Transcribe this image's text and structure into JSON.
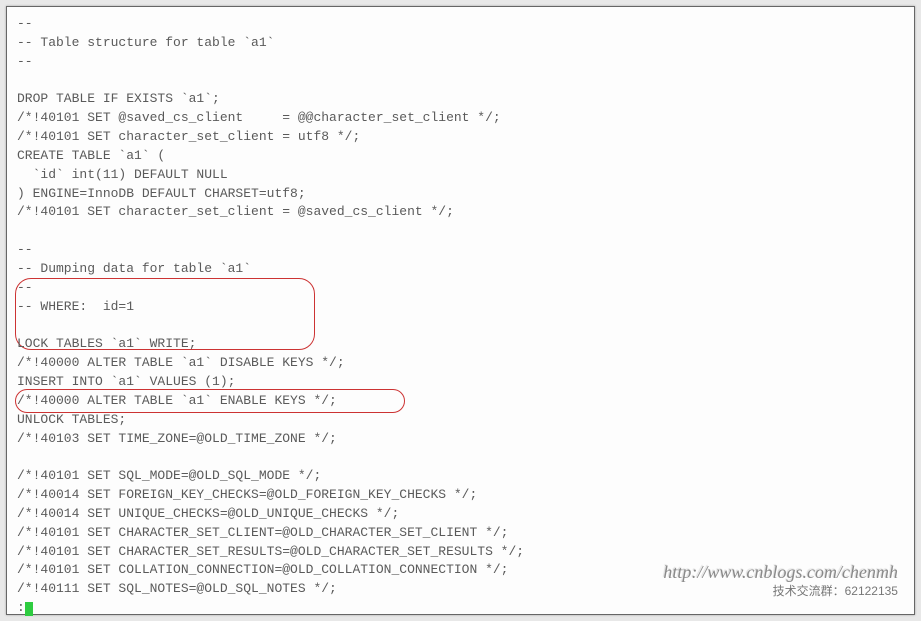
{
  "lines": [
    "--",
    "-- Table structure for table `a1`",
    "--",
    "",
    "DROP TABLE IF EXISTS `a1`;",
    "/*!40101 SET @saved_cs_client     = @@character_set_client */;",
    "/*!40101 SET character_set_client = utf8 */;",
    "CREATE TABLE `a1` (",
    "  `id` int(11) DEFAULT NULL",
    ") ENGINE=InnoDB DEFAULT CHARSET=utf8;",
    "/*!40101 SET character_set_client = @saved_cs_client */;",
    "",
    "--",
    "-- Dumping data for table `a1`",
    "--",
    "-- WHERE:  id=1",
    "",
    "LOCK TABLES `a1` WRITE;",
    "/*!40000 ALTER TABLE `a1` DISABLE KEYS */;",
    "INSERT INTO `a1` VALUES (1);",
    "/*!40000 ALTER TABLE `a1` ENABLE KEYS */;",
    "UNLOCK TABLES;",
    "/*!40103 SET TIME_ZONE=@OLD_TIME_ZONE */;",
    "",
    "/*!40101 SET SQL_MODE=@OLD_SQL_MODE */;",
    "/*!40014 SET FOREIGN_KEY_CHECKS=@OLD_FOREIGN_KEY_CHECKS */;",
    "/*!40014 SET UNIQUE_CHECKS=@OLD_UNIQUE_CHECKS */;",
    "/*!40101 SET CHARACTER_SET_CLIENT=@OLD_CHARACTER_SET_CLIENT */;",
    "/*!40101 SET CHARACTER_SET_RESULTS=@OLD_CHARACTER_SET_RESULTS */;",
    "/*!40101 SET COLLATION_CONNECTION=@OLD_COLLATION_CONNECTION */;",
    "/*!40111 SET SQL_NOTES=@OLD_SQL_NOTES */;"
  ],
  "prompt": {
    "symbol": ":"
  },
  "watermark": {
    "url": "http://www.cnblogs.com/chenmh",
    "group": "技术交流群：62122135"
  }
}
